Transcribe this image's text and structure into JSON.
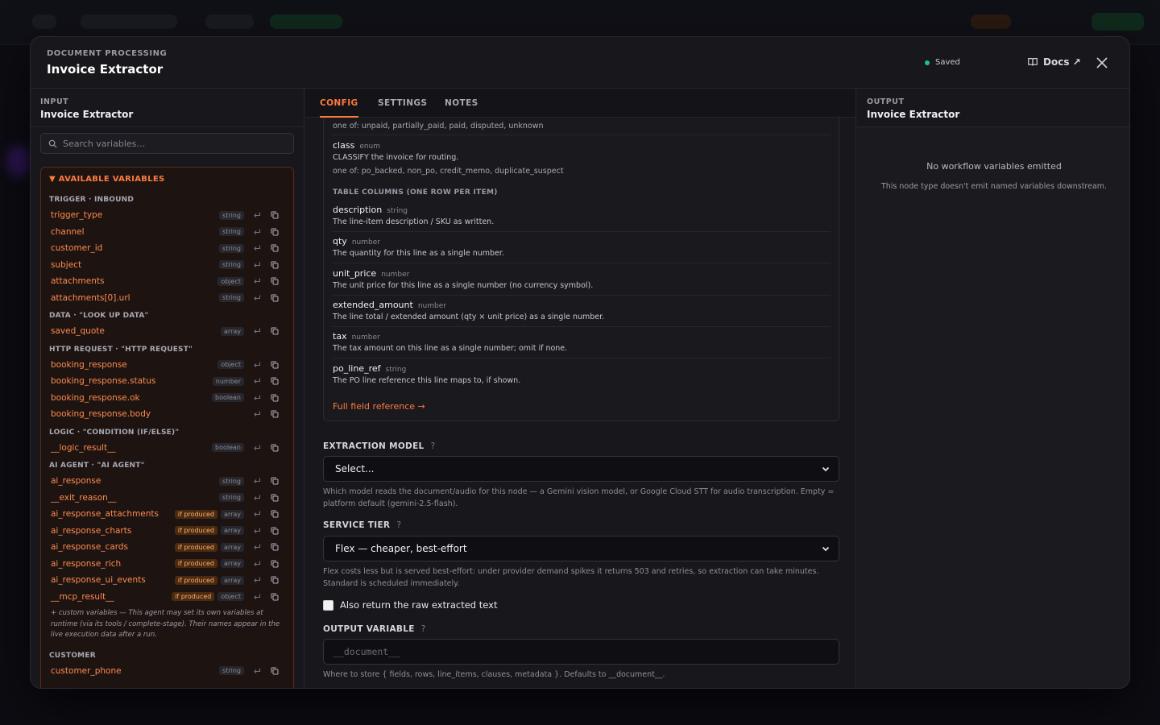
{
  "header": {
    "eyebrow": "DOCUMENT PROCESSING",
    "title": "Invoice Extractor",
    "status": "Saved",
    "docs_label": "Docs ↗"
  },
  "left": {
    "eyebrow": "INPUT",
    "title": "Invoice Extractor",
    "search_placeholder": "Search variables…",
    "vars_title": "▼ AVAILABLE VARIABLES",
    "sections": [
      {
        "title": "TRIGGER · INBOUND",
        "items": [
          {
            "name": "trigger_type",
            "type": "string",
            "produced": ""
          },
          {
            "name": "channel",
            "type": "string",
            "produced": ""
          },
          {
            "name": "customer_id",
            "type": "string",
            "produced": ""
          },
          {
            "name": "subject",
            "type": "string",
            "produced": ""
          },
          {
            "name": "attachments",
            "type": "object",
            "produced": ""
          },
          {
            "name": "attachments[0].url",
            "type": "string",
            "produced": ""
          }
        ]
      },
      {
        "title": "DATA · \"LOOK UP DATA\"",
        "items": [
          {
            "name": "saved_quote",
            "type": "array",
            "produced": ""
          }
        ]
      },
      {
        "title": "HTTP REQUEST · \"HTTP REQUEST\"",
        "items": [
          {
            "name": "booking_response",
            "type": "object",
            "produced": ""
          },
          {
            "name": "booking_response.status",
            "type": "number",
            "produced": ""
          },
          {
            "name": "booking_response.ok",
            "type": "boolean",
            "produced": ""
          },
          {
            "name": "booking_response.body",
            "type": "",
            "produced": ""
          }
        ]
      },
      {
        "title": "LOGIC · \"CONDITION (IF/ELSE)\"",
        "items": [
          {
            "name": "__logic_result__",
            "type": "boolean",
            "produced": ""
          }
        ]
      },
      {
        "title": "AI AGENT · \"AI AGENT\"",
        "items": [
          {
            "name": "ai_response",
            "type": "string",
            "produced": ""
          },
          {
            "name": "__exit_reason__",
            "type": "string",
            "produced": ""
          },
          {
            "name": "ai_response_attachments",
            "type": "array",
            "produced": "if produced"
          },
          {
            "name": "ai_response_charts",
            "type": "array",
            "produced": "if produced"
          },
          {
            "name": "ai_response_cards",
            "type": "array",
            "produced": "if produced"
          },
          {
            "name": "ai_response_rich",
            "type": "array",
            "produced": "if produced"
          },
          {
            "name": "ai_response_ui_events",
            "type": "array",
            "produced": "if produced"
          },
          {
            "name": "__mcp_result__",
            "type": "object",
            "produced": "if produced"
          }
        ],
        "note": "+ custom variables — This agent may set its own variables at runtime (via its tools / complete-stage). Their names appear in the live execution data after a run."
      },
      {
        "title": "CUSTOMER",
        "items": [
          {
            "name": "customer_phone",
            "type": "string",
            "produced": ""
          }
        ]
      }
    ]
  },
  "center": {
    "tabs": [
      "CONFIG",
      "SETTINGS",
      "NOTES"
    ],
    "fields_top_text": "one of: unpaid, partially_paid, paid, disputed, unknown",
    "class_field": {
      "name": "class",
      "type": "enum",
      "desc": "CLASSIFY the invoice for routing.",
      "options": "one of: po_backed, non_po, credit_memo, duplicate_suspect"
    },
    "table_section": "TABLE COLUMNS (ONE ROW PER ITEM)",
    "columns": [
      {
        "name": "description",
        "type": "string",
        "desc": "The line-item description / SKU as written."
      },
      {
        "name": "qty",
        "type": "number",
        "desc": "The quantity for this line as a single number."
      },
      {
        "name": "unit_price",
        "type": "number",
        "desc": "The unit price for this line as a single number (no currency symbol)."
      },
      {
        "name": "extended_amount",
        "type": "number",
        "desc": "The line total / extended amount (qty × unit price) as a single number."
      },
      {
        "name": "tax",
        "type": "number",
        "desc": "The tax amount on this line as a single number; omit if none."
      },
      {
        "name": "po_line_ref",
        "type": "string",
        "desc": "The PO line reference this line maps to, if shown."
      }
    ],
    "full_ref_link": "Full field reference →",
    "extraction_model": {
      "label": "EXTRACTION MODEL",
      "value": "Select...",
      "help": "Which model reads the document/audio for this node — a Gemini vision model, or Google Cloud STT for audio transcription. Empty = platform default (gemini-2.5-flash)."
    },
    "service_tier": {
      "label": "SERVICE TIER",
      "value": "Flex — cheaper, best-effort",
      "help": "Flex costs less but is served best-effort: under provider demand spikes it returns 503 and retries, so extraction can take minutes. Standard is scheduled immediately."
    },
    "raw_text_label": "Also return the raw extracted text",
    "output_variable": {
      "label": "OUTPUT VARIABLE",
      "placeholder": "__document__",
      "help": "Where to store { fields, rows, line_items, clauses, metadata }. Defaults to __document__."
    },
    "help_mark": "?"
  },
  "right": {
    "eyebrow": "OUTPUT",
    "title": "Invoice Extractor",
    "empty_title": "No workflow variables emitted",
    "empty_sub": "This node type doesn't emit named variables downstream."
  }
}
